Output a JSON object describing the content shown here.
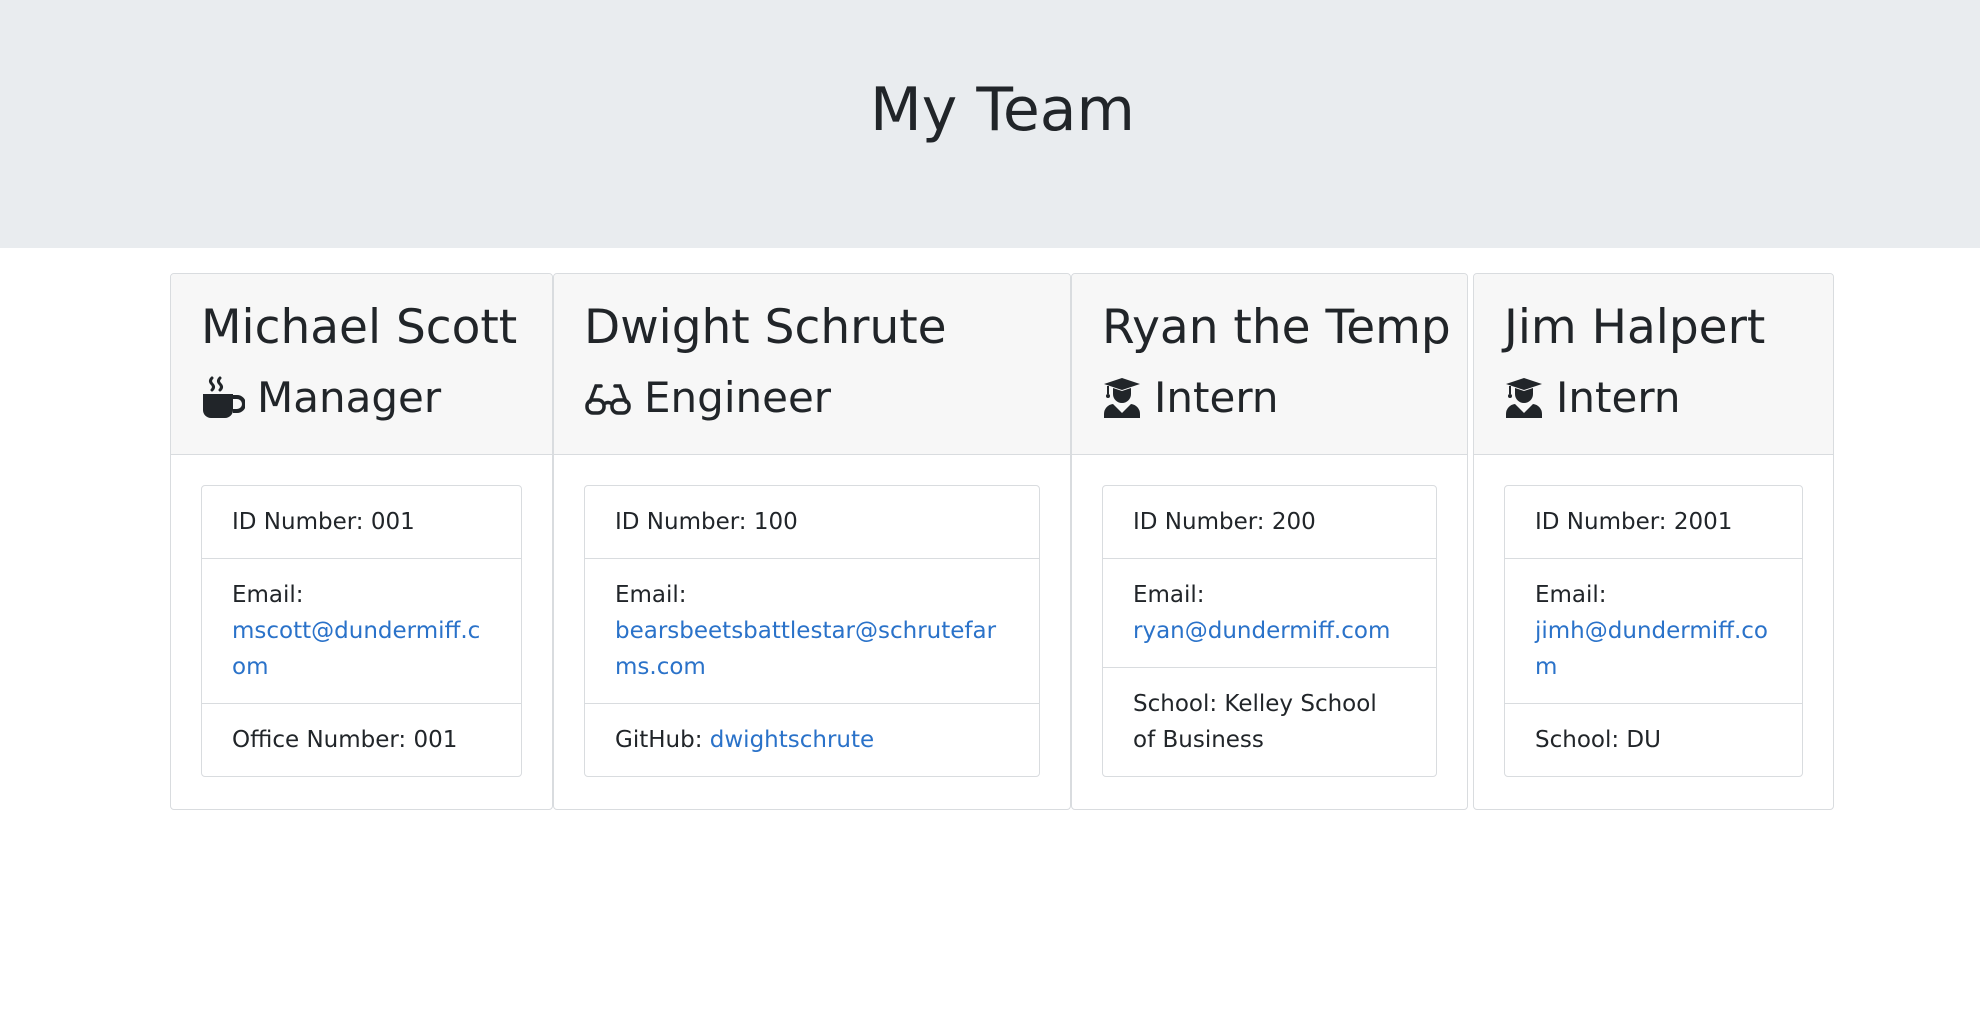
{
  "header": {
    "title": "My Team"
  },
  "colors": {
    "accent_link": "#2a72c9",
    "header_bg": "#e9ecef",
    "card_header_bg": "#f7f7f7"
  },
  "cards": [
    {
      "name": "Michael Scott",
      "role": "Manager",
      "icon": "mug-icon",
      "id_label": "ID Number: 001",
      "email_label": "Email:",
      "email": "mscott@dundermiff.com",
      "extra_label": "Office Number: 001"
    },
    {
      "name": "Dwight Schrute",
      "role": "Engineer",
      "icon": "glasses-icon",
      "id_label": "ID Number: 100",
      "email_label": "Email:",
      "email": "bearsbeetsbattlestar@schrutefarms.com",
      "extra_label": "GitHub: ",
      "extra_link": "dwightschrute"
    },
    {
      "name": "Ryan the Temp",
      "role": "Intern",
      "icon": "graduate-icon",
      "id_label": "ID Number: 200",
      "email_label": "Email:",
      "email": "ryan@dundermiff.com",
      "extra_label": "School: Kelley School of Business"
    },
    {
      "name": "Jim Halpert",
      "role": "Intern",
      "icon": "graduate-icon",
      "id_label": "ID Number: 2001",
      "email_label": "Email:",
      "email": "jimh@dundermiff.com",
      "extra_label": "School: DU"
    }
  ]
}
